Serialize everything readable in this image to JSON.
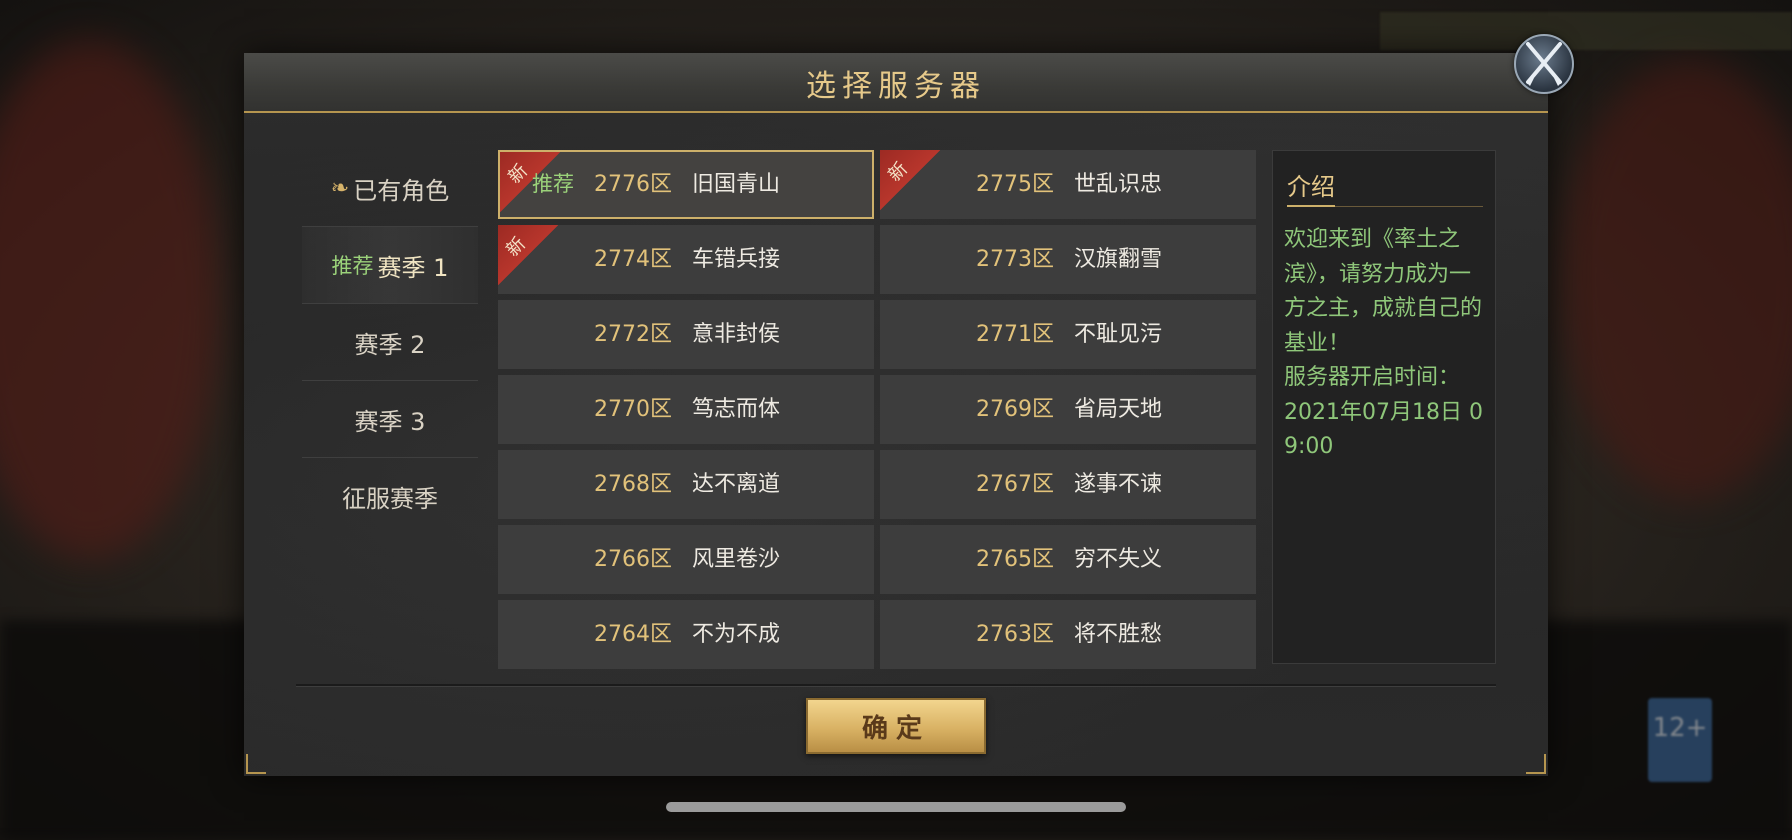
{
  "dialog": {
    "title": "选择服务器",
    "close_icon": "crossed-swords-icon"
  },
  "menu": {
    "items": [
      {
        "label": "已有角色",
        "icon": "character-icon",
        "recommended": false,
        "active": false
      },
      {
        "label": "赛季 1",
        "prefix": "推荐",
        "recommended": true,
        "active": true
      },
      {
        "label": "赛季 2",
        "recommended": false,
        "active": false
      },
      {
        "label": "赛季 3",
        "recommended": false,
        "active": false
      },
      {
        "label": "征服赛季",
        "recommended": false,
        "active": false
      }
    ]
  },
  "servers": [
    {
      "zone": "2776区",
      "name": "旧国青山",
      "new": true,
      "new_label": "新",
      "recommend_label": "推荐",
      "selected": true
    },
    {
      "zone": "2775区",
      "name": "世乱识忠",
      "new": true,
      "new_label": "新",
      "selected": false
    },
    {
      "zone": "2774区",
      "name": "车错兵接",
      "new": true,
      "new_label": "新",
      "selected": false
    },
    {
      "zone": "2773区",
      "name": "汉旗翻雪",
      "new": false,
      "selected": false
    },
    {
      "zone": "2772区",
      "name": "意非封侯",
      "new": false,
      "selected": false
    },
    {
      "zone": "2771区",
      "name": "不耻见污",
      "new": false,
      "selected": false
    },
    {
      "zone": "2770区",
      "name": "笃志而体",
      "new": false,
      "selected": false
    },
    {
      "zone": "2769区",
      "name": "省局天地",
      "new": false,
      "selected": false
    },
    {
      "zone": "2768区",
      "name": "达不离道",
      "new": false,
      "selected": false
    },
    {
      "zone": "2767区",
      "name": "遂事不谏",
      "new": false,
      "selected": false
    },
    {
      "zone": "2766区",
      "name": "风里卷沙",
      "new": false,
      "selected": false
    },
    {
      "zone": "2765区",
      "name": "穷不失义",
      "new": false,
      "selected": false
    },
    {
      "zone": "2764区",
      "name": "不为不成",
      "new": false,
      "selected": false
    },
    {
      "zone": "2763区",
      "name": "将不胜愁",
      "new": false,
      "selected": false
    }
  ],
  "intro": {
    "title": "介绍",
    "body": "欢迎来到《率土之滨》，请努力成为一方之主，成就自己的基业！",
    "open_time_label": "服务器开启时间：",
    "open_time": "2021年07月18日 09:00"
  },
  "confirm_label": "确定",
  "colors": {
    "gold": "#e6c98a",
    "zone_gold": "#e2c27a",
    "green": "#8fc77a",
    "ribbon_red": "#b8362c"
  }
}
